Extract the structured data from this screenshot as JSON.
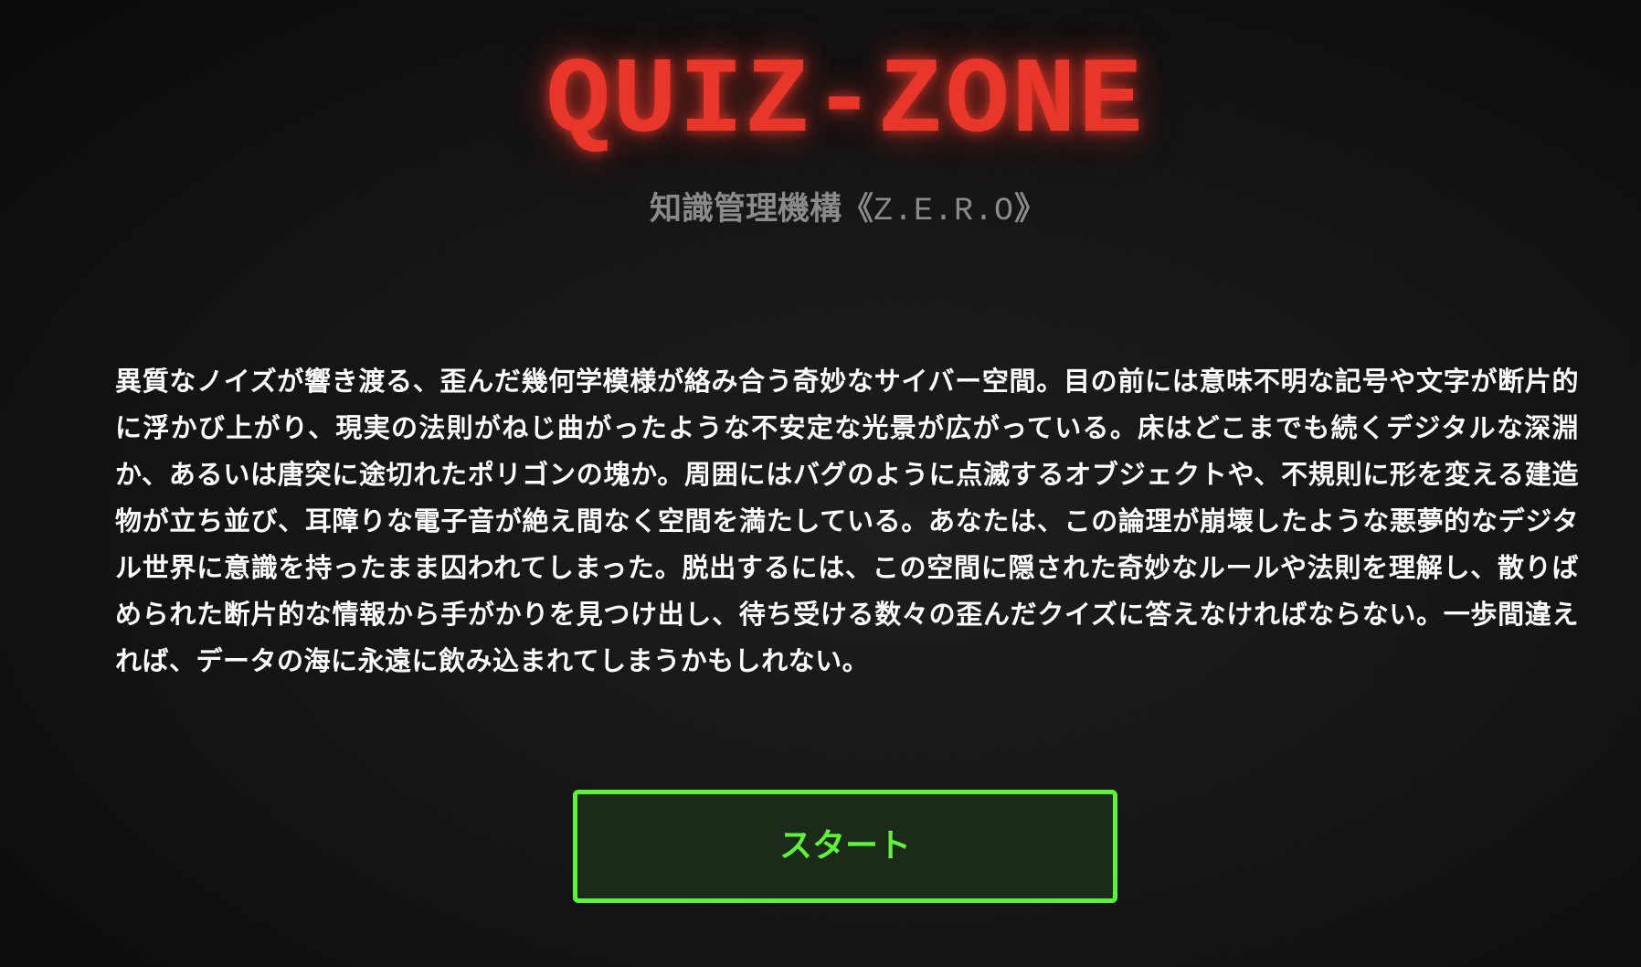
{
  "title": "QUIZ-ZONE",
  "subtitle": {
    "jp": "知識管理機構",
    "open": "《",
    "code": "Z.E.R.O",
    "close": "》"
  },
  "story": "異質なノイズが響き渡る、歪んだ幾何学模様が絡み合う奇妙なサイバー空間。目の前には意味不明な記号や文字が断片的に浮かび上がり、現実の法則がねじ曲がったような不安定な光景が広がっている。床はどこまでも続くデジタルな深淵か、あるいは唐突に途切れたポリゴンの塊か。周囲にはバグのように点滅するオブジェクトや、不規則に形を変える建造物が立ち並び、耳障りな電子音が絶え間なく空間を満たしている。あなたは、この論理が崩壊したような悪夢的なデジタル世界に意識を持ったまま囚われてしまった。脱出するには、この空間に隠された奇妙なルールや法則を理解し、散りばめられた断片的な情報から手がかりを見つけ出し、待ち受ける数々の歪んだクイズに答えなければならない。一歩間違えれば、データの海に永遠に飲み込まれてしまうかもしれない。",
  "start_button": {
    "label": "スタート"
  },
  "colors": {
    "title": "#e8362a",
    "subtitle": "#8a8a8a",
    "story_text": "#ffffff",
    "button_border": "#5ff23a",
    "button_text": "#5ff23a",
    "button_background": "#1c2a19",
    "background": "#141414"
  }
}
